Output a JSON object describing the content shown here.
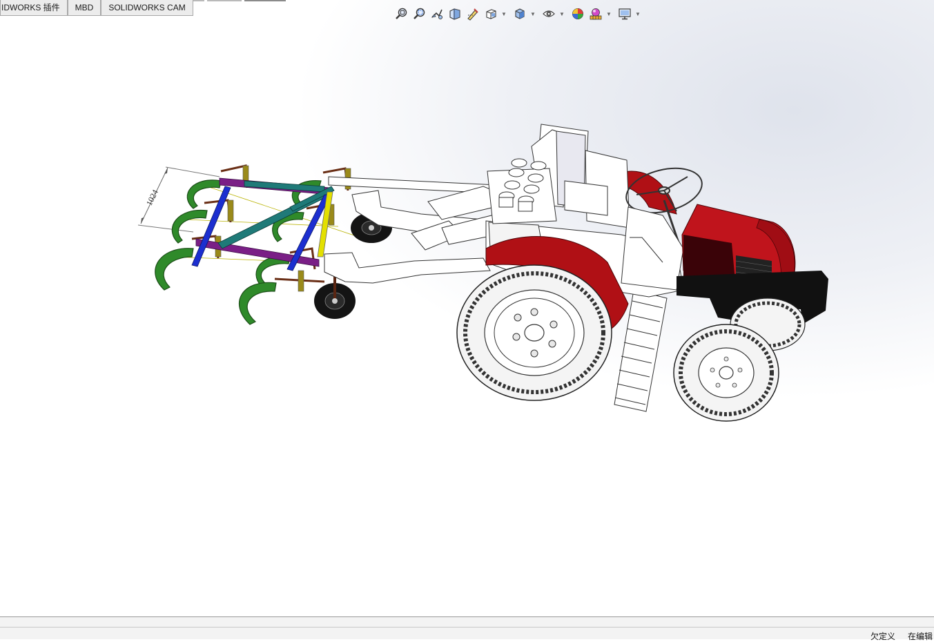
{
  "tabs": [
    {
      "label": "IDWORKS 插件"
    },
    {
      "label": "MBD"
    },
    {
      "label": "SOLIDWORKS CAM"
    }
  ],
  "view_toolbar": {
    "icons": [
      "zoom-to-fit-icon",
      "zoom-to-area-icon",
      "previous-view-icon",
      "section-view-icon",
      "dynamic-annotation-icon",
      "view-orientation-icon",
      "display-style-icon",
      "hide-show-items-icon",
      "edit-appearance-icon",
      "apply-scene-icon",
      "view-settings-icon"
    ]
  },
  "model": {
    "dimension_label": "1024",
    "colors": {
      "fender": "#b01015",
      "hood": "#c0141c",
      "frame": "#ffffff",
      "tire": "#f4f4f4",
      "bumper": "#111111",
      "tine": "#2f8a2a",
      "bar_teal": "#1f7a78",
      "bar_purple": "#7a1f86",
      "bar_blue": "#1c2fd0",
      "bar_yellow": "#e3e000",
      "gauge_wheel": "#141414"
    }
  },
  "status": {
    "underdefined": "欠定义",
    "editing": "在编辑"
  }
}
